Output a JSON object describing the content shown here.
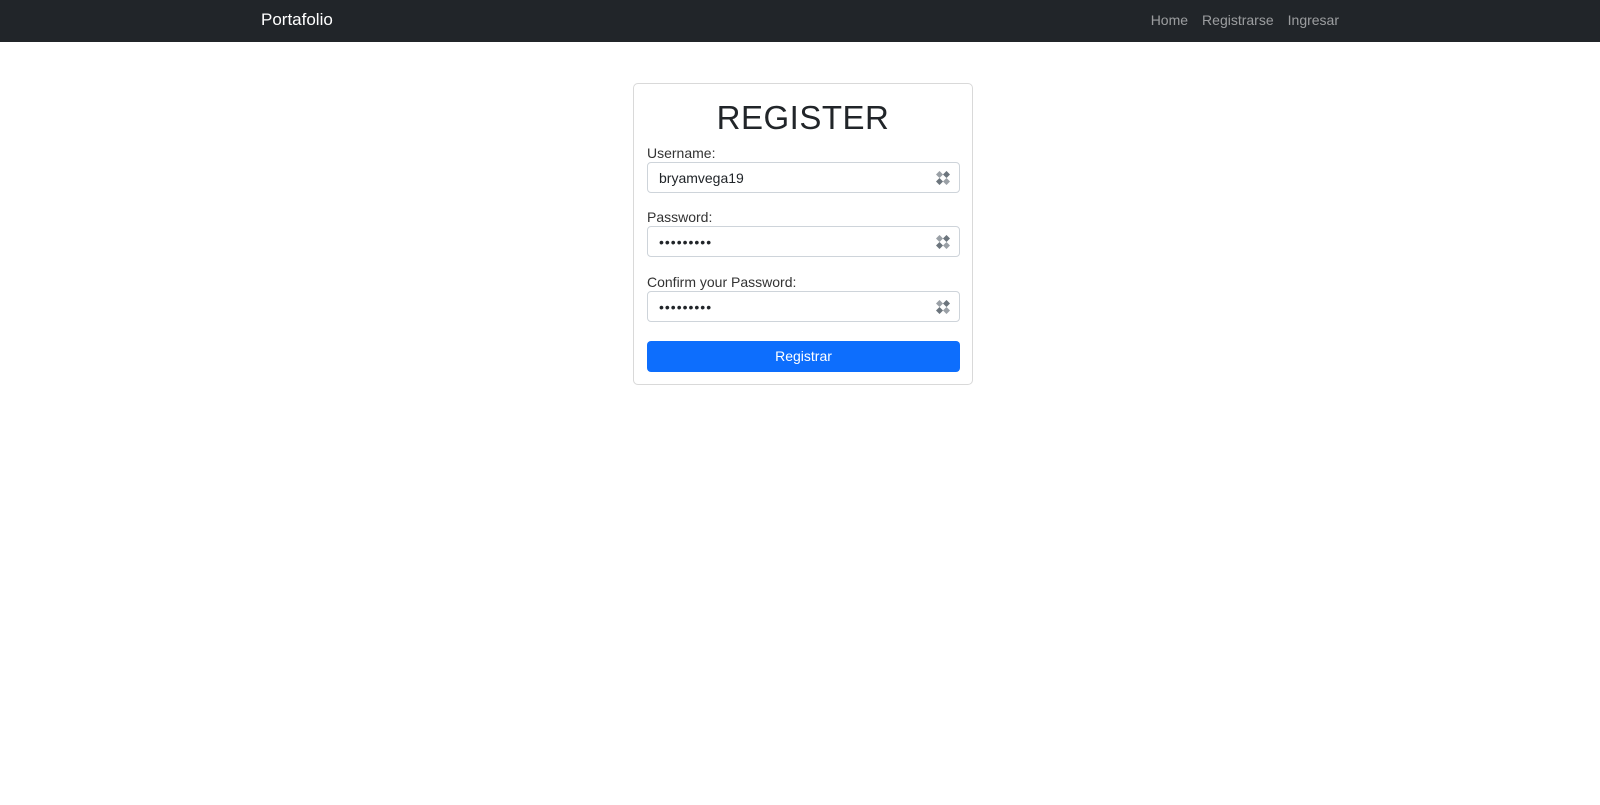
{
  "navbar": {
    "brand": "Portafolio",
    "links": [
      {
        "label": "Home"
      },
      {
        "label": "Registrarse"
      },
      {
        "label": "Ingresar"
      }
    ]
  },
  "form": {
    "title": "REGISTER",
    "username": {
      "label": "Username:",
      "value": "bryamvega19"
    },
    "password": {
      "label": "Password:",
      "value": "•••••••••"
    },
    "confirm": {
      "label": "Confirm your Password:",
      "value": "•••••••••"
    },
    "submit_label": "Registrar"
  },
  "colors": {
    "navbar_bg": "#212529",
    "primary": "#0d6efd"
  },
  "icons": {
    "field_action": "password-manager-key-icon"
  }
}
